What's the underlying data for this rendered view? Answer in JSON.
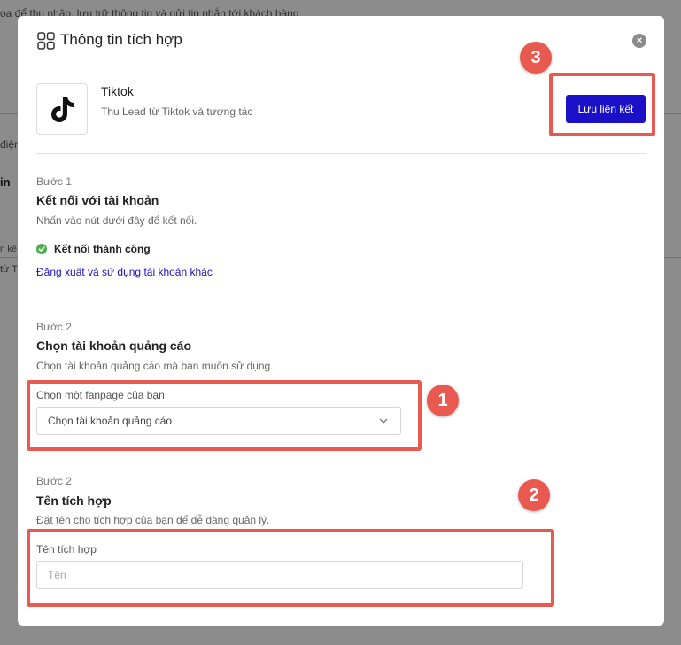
{
  "background": {
    "line1": "oa để thu nhập, lưu trữ thông tin và gửi tin nhắn tới khách hàng",
    "line2": "điện",
    "line3": "in",
    "line4": "n kế",
    "line5": "từ T"
  },
  "modal": {
    "title": "Thông tin tích hợp",
    "close_label": "×"
  },
  "app": {
    "name": "Tiktok",
    "description": "Thu Lead từ Tiktok và tương tác",
    "save_label": "Lưu liên kết"
  },
  "step1": {
    "label": "Bước 1",
    "title": "Kết nối với tài khoản",
    "description": "Nhấn vào nút dưới đây để kết nối.",
    "status": "Kết nối thành công",
    "logout_link": "Đăng xuất và sử dụng tài khoản khác"
  },
  "step2": {
    "label": "Bước 2",
    "title": "Chọn tài khoản quảng cáo",
    "description": "Chọn tài khoản quảng cáo mà bạn muốn sử dụng.",
    "field_label": "Chọn một fanpage của bạn",
    "select_value": "Chọn tài khoản quảng cáo"
  },
  "step3": {
    "label": "Bước 2",
    "title": "Tên tích hợp",
    "description": "Đặt tên cho tích hợp của bạn để dễ dàng quản lý.",
    "field_label": "Tên tích hợp",
    "input_placeholder": "Tên",
    "input_value": ""
  },
  "annotations": {
    "one": "1",
    "two": "2",
    "three": "3"
  },
  "colors": {
    "accent": "#1a10c8",
    "annotation": "#e85a50",
    "success": "#4cae4f"
  }
}
